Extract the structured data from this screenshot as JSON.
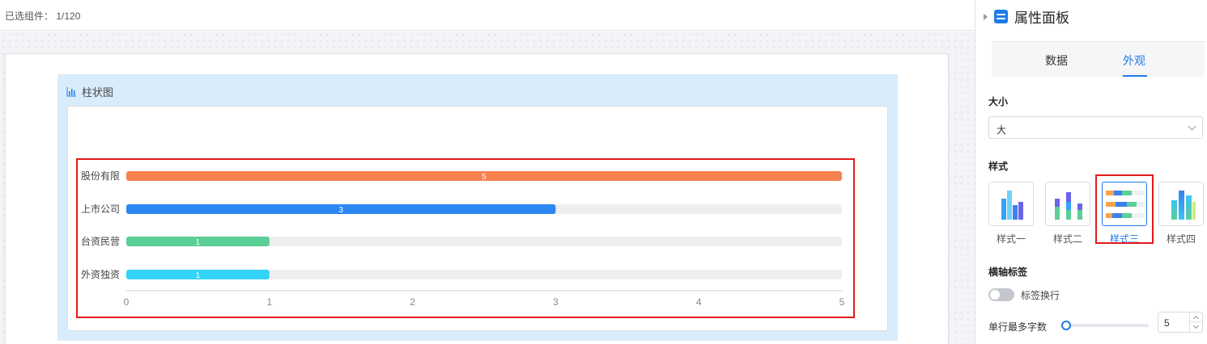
{
  "topbar": {
    "selected_label": "已选组件：",
    "selected_count": "1/120"
  },
  "widget": {
    "title": "柱状图",
    "icon": "bar-chart-icon"
  },
  "chart_data": {
    "type": "bar",
    "orientation": "horizontal",
    "categories": [
      "股份有限",
      "上市公司",
      "台资民营",
      "外资独资"
    ],
    "values": [
      5,
      3,
      1,
      1
    ],
    "colors": [
      "#f5824f",
      "#2b87f2",
      "#5cce97",
      "#33d4f7"
    ],
    "track_color": "#eeeeee",
    "xlim": [
      0,
      5
    ],
    "xticks": [
      0,
      1,
      2,
      3,
      4,
      5
    ],
    "data_labels": true,
    "grid": false
  },
  "panel": {
    "title": "属性面板",
    "tabs": [
      {
        "label": "数据",
        "active": false
      },
      {
        "label": "外观",
        "active": true
      }
    ],
    "size": {
      "label": "大小",
      "value": "大"
    },
    "style": {
      "label": "样式",
      "options": [
        {
          "label": "样式一",
          "active": false
        },
        {
          "label": "样式二",
          "active": false
        },
        {
          "label": "样式三",
          "active": true
        },
        {
          "label": "样式四",
          "active": false
        }
      ]
    },
    "axis_label": {
      "label": "横轴标签",
      "wrap_label": "标签换行",
      "wrap_on": false
    },
    "max_chars": {
      "label": "单行最多字数",
      "value": "5"
    }
  },
  "accent_color": "#1e7ce8",
  "highlight_color": "#e01b1b"
}
